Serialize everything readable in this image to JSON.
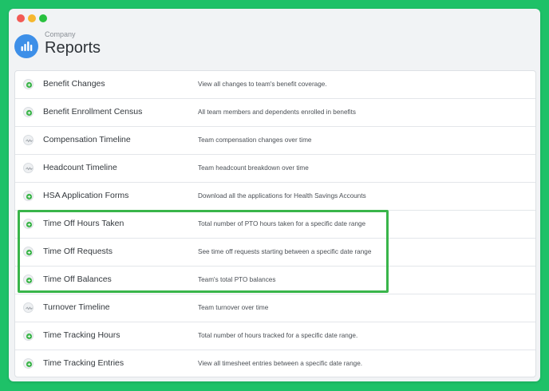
{
  "window": {
    "controls": [
      "close",
      "minimize",
      "maximize"
    ]
  },
  "header": {
    "icon": "bar-chart-icon",
    "breadcrumb": "Company",
    "title": "Reports"
  },
  "colors": {
    "background": "#1ec168",
    "highlight": "#39b54a",
    "app_icon": "#3d8fe8"
  },
  "reports": [
    {
      "name": "Benefit Changes",
      "description": "View all changes to team's benefit coverage.",
      "icon": "plus-download-icon"
    },
    {
      "name": "Benefit Enrollment Census",
      "description": "All team members and dependents enrolled in benefits",
      "icon": "plus-download-icon"
    },
    {
      "name": "Compensation Timeline",
      "description": "Team compensation changes over time",
      "icon": "timeline-icon"
    },
    {
      "name": "Headcount Timeline",
      "description": "Team headcount breakdown over time",
      "icon": "timeline-icon"
    },
    {
      "name": "HSA Application Forms",
      "description": "Download all the applications for Health Savings Accounts",
      "icon": "plus-download-icon"
    },
    {
      "name": "Time Off Hours Taken",
      "description": "Total number of PTO hours taken for a specific date range",
      "icon": "plus-download-icon"
    },
    {
      "name": "Time Off Requests",
      "description": "See time off requests starting between a specific date range",
      "icon": "plus-download-icon"
    },
    {
      "name": "Time Off Balances",
      "description": "Team's total PTO balances",
      "icon": "plus-download-icon"
    },
    {
      "name": "Turnover Timeline",
      "description": "Team turnover over time",
      "icon": "timeline-icon"
    },
    {
      "name": "Time Tracking Hours",
      "description": "Total number of hours tracked for a specific date range.",
      "icon": "plus-download-icon"
    },
    {
      "name": "Time Tracking Entries",
      "description": "View all timesheet entries between a specific date range.",
      "icon": "plus-download-icon"
    }
  ]
}
